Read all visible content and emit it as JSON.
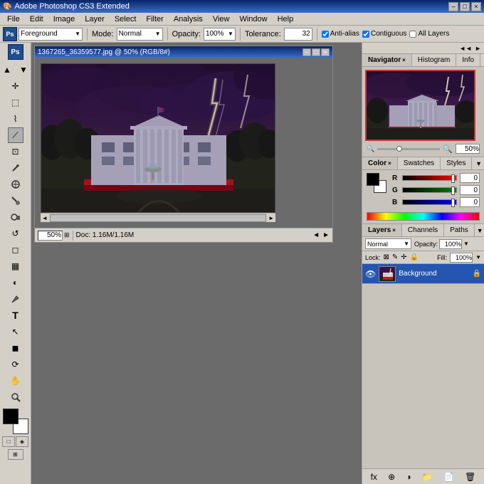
{
  "app": {
    "title": "Adobe Photoshop CS3 Extended",
    "title_icon": "Ps"
  },
  "titlebar": {
    "title": "Adobe Photoshop CS3 Extended",
    "minimize": "–",
    "maximize": "□",
    "close": "×"
  },
  "menubar": {
    "items": [
      "File",
      "Edit",
      "Image",
      "Layer",
      "Select",
      "Filter",
      "Analysis",
      "View",
      "Window",
      "Help"
    ]
  },
  "optionsbar": {
    "tool_preset_label": "Foreground",
    "mode_label": "Mode:",
    "mode_value": "Normal",
    "opacity_label": "Opacity:",
    "opacity_value": "100%",
    "tolerance_label": "Tolerance:",
    "tolerance_value": "32",
    "anti_alias_label": "Anti-alias",
    "contiguous_label": "Contiguous",
    "all_layers_label": "All Layers"
  },
  "document": {
    "title": "1367265_36359577.jpg @ 50% (RGB/8#)",
    "zoom": "50%",
    "status": "Doc: 1.16M/1.16M",
    "close": "×",
    "minimize": "–",
    "maximize": "□"
  },
  "toolbar": {
    "tools": [
      {
        "name": "move",
        "icon": "✛"
      },
      {
        "name": "rectangular-marquee",
        "icon": "⬚"
      },
      {
        "name": "lasso",
        "icon": "⌇"
      },
      {
        "name": "magic-wand",
        "icon": "⟋"
      },
      {
        "name": "crop",
        "icon": "⊡"
      },
      {
        "name": "eyedropper",
        "icon": "✒"
      },
      {
        "name": "healing-brush",
        "icon": "⊕"
      },
      {
        "name": "brush",
        "icon": "🖌"
      },
      {
        "name": "clone-stamp",
        "icon": "✎"
      },
      {
        "name": "history-brush",
        "icon": "↺"
      },
      {
        "name": "eraser",
        "icon": "◻"
      },
      {
        "name": "gradient",
        "icon": "▦"
      },
      {
        "name": "dodge",
        "icon": "◐"
      },
      {
        "name": "pen",
        "icon": "✒"
      },
      {
        "name": "text",
        "icon": "T"
      },
      {
        "name": "path-selection",
        "icon": "↖"
      },
      {
        "name": "rectangle-shape",
        "icon": "◼"
      },
      {
        "name": "3d-rotate",
        "icon": "⟳"
      },
      {
        "name": "hand",
        "icon": "✋"
      },
      {
        "name": "zoom",
        "icon": "🔍"
      }
    ]
  },
  "navigator": {
    "tabs": [
      {
        "label": "Navigator",
        "active": true
      },
      {
        "label": "Histogram"
      },
      {
        "label": "Info"
      }
    ],
    "zoom_value": "50%"
  },
  "color": {
    "tabs": [
      {
        "label": "Color",
        "active": true
      },
      {
        "label": "Swatches"
      },
      {
        "label": "Styles"
      }
    ],
    "r_label": "R",
    "g_label": "G",
    "b_label": "B",
    "r_value": "0",
    "g_value": "0",
    "b_value": "0"
  },
  "layers": {
    "tabs": [
      {
        "label": "Layers",
        "active": true
      },
      {
        "label": "Channels"
      },
      {
        "label": "Paths"
      }
    ],
    "blend_mode": "Normal",
    "opacity_label": "Opacity:",
    "opacity_value": "100%",
    "lock_label": "Lock:",
    "fill_label": "Fill:",
    "fill_value": "100%",
    "layers_list": [
      {
        "name": "Background",
        "visible": true,
        "active": true,
        "locked": true
      }
    ],
    "footer_btns": [
      "fx",
      "⊕",
      "◻",
      "⊟",
      "🗑"
    ]
  }
}
